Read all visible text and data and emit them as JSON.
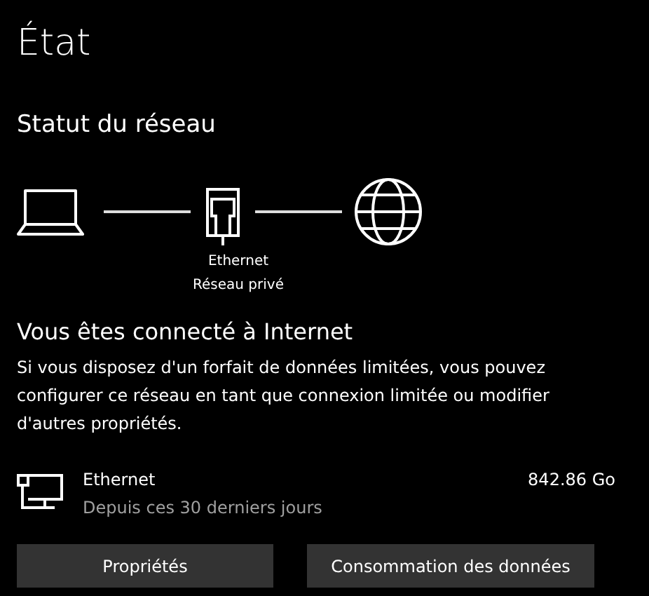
{
  "page_title": "État",
  "section_title": "Statut du réseau",
  "diagram": {
    "adapter_name": "Ethernet",
    "network_type": "Réseau privé"
  },
  "status_heading": "Vous êtes connecté à Internet",
  "status_text": "Si vous disposez d'un forfait de données limitées, vous pouvez configurer ce réseau en tant que connexion limitée ou modifier d'autres propriétés.",
  "usage": {
    "name": "Ethernet",
    "period": "Depuis ces 30 derniers jours",
    "amount": "842.86 Go"
  },
  "buttons": [
    {
      "label": "Propriétés"
    },
    {
      "label": "Consommation des données"
    }
  ]
}
